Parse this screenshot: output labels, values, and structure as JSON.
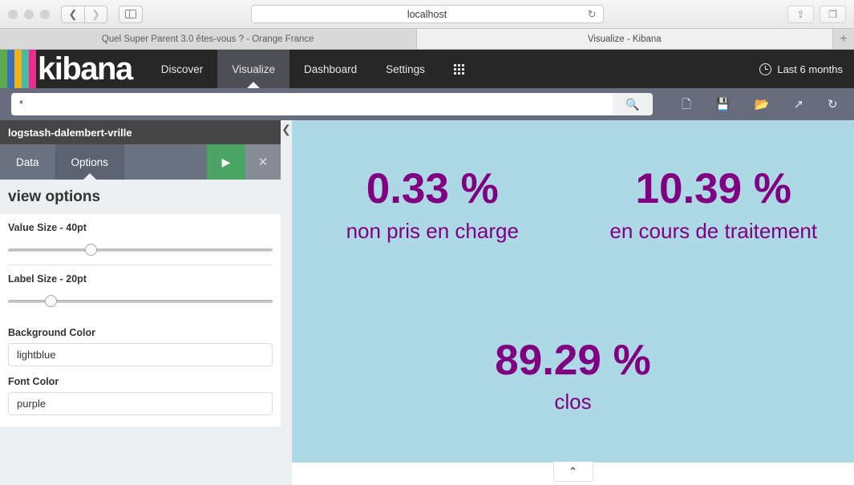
{
  "browser": {
    "url": "localhost",
    "reload_icon": "reload-icon",
    "back_icon": "chevron-left-icon",
    "forward_icon": "chevron-right-icon",
    "sidebar_icon": "sidebar-toggle-icon",
    "share_icon": "share-icon",
    "tabs_overview_icon": "tabs-overview-icon",
    "new_tab_label": "+",
    "tabs": [
      {
        "title": "Quel Super Parent 3.0 êtes-vous ? - Orange France",
        "active": false
      },
      {
        "title": "Visualize - Kibana",
        "active": true
      }
    ]
  },
  "kibana": {
    "brand": "kibana",
    "stripe_colors": [
      "#5da94e",
      "#3b6fb6",
      "#f2b21c",
      "#4bb8a8",
      "#ec2d8f"
    ],
    "nav_items": [
      {
        "label": "Discover",
        "active": false
      },
      {
        "label": "Visualize",
        "active": true
      },
      {
        "label": "Dashboard",
        "active": false
      },
      {
        "label": "Settings",
        "active": false
      }
    ],
    "apps_icon": "apps-grid-icon",
    "time_picker": {
      "icon": "clock-icon",
      "label": "Last 6 months"
    }
  },
  "query": {
    "value": "*",
    "placeholder": "",
    "search_icon": "search-icon",
    "actions": [
      {
        "icon": "new-document-icon",
        "glyph": "🗎"
      },
      {
        "icon": "save-icon",
        "glyph": "💾"
      },
      {
        "icon": "open-folder-icon",
        "glyph": "📂"
      },
      {
        "icon": "share-external-icon",
        "glyph": "↗"
      },
      {
        "icon": "refresh-icon",
        "glyph": "↻"
      }
    ]
  },
  "sidepanel": {
    "index_title": "logstash-dalembert-vrille",
    "tabs": [
      {
        "label": "Data",
        "active": false
      },
      {
        "label": "Options",
        "active": true
      }
    ],
    "apply_label": "▶",
    "cancel_label": "✕",
    "heading": "view options",
    "sliders": [
      {
        "label": "Value Size - 40pt",
        "percent": 29
      },
      {
        "label": "Label Size - 20pt",
        "percent": 14
      }
    ],
    "fields": [
      {
        "label": "Background Color",
        "value": "lightblue"
      },
      {
        "label": "Font Color",
        "value": "purple"
      }
    ],
    "collapse_icon": "chevron-left-icon"
  },
  "visualization": {
    "background_color": "#add8e6",
    "font_color": "#800080",
    "metrics": [
      {
        "value": "0.33 %",
        "label": "non pris en charge"
      },
      {
        "value": "10.39 %",
        "label": "en cours de traitement"
      },
      {
        "value": "89.29 %",
        "label": "clos"
      }
    ],
    "toggle_icon": "chevron-up-icon",
    "toggle_glyph": "⌃"
  }
}
